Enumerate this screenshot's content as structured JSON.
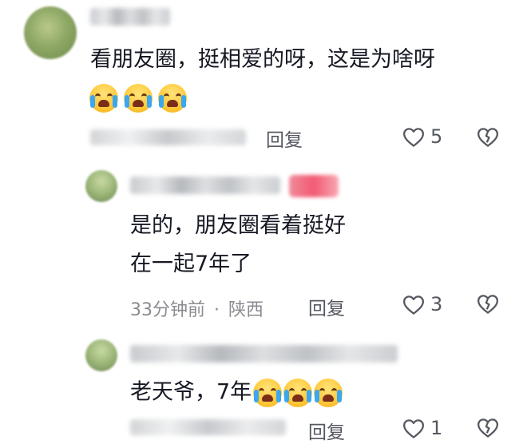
{
  "comments": [
    {
      "text_line1": "看朋友圈，挺相爱的呀，这是为啥呀",
      "emoji_icon": "loudly-crying-face",
      "emoji_count": 3,
      "reply_label": "回复",
      "likes": "5"
    },
    {
      "text_line1": "是的，朋友圈看着挺好",
      "text_line2": "在一起7年了",
      "time": "33分钟前",
      "location": "陕西",
      "separator": "·",
      "reply_label": "回复",
      "likes": "3"
    },
    {
      "text_line1": "老天爷，7年",
      "emoji_icon": "loudly-crying-face",
      "emoji_count": 3,
      "reply_label": "回复",
      "likes": "1"
    }
  ],
  "icons": {
    "like": "heart-outline-icon",
    "dislike": "broken-heart-outline-icon"
  },
  "colors": {
    "text": "#161823",
    "meta": "#8a8b91",
    "icon": "#555860"
  }
}
